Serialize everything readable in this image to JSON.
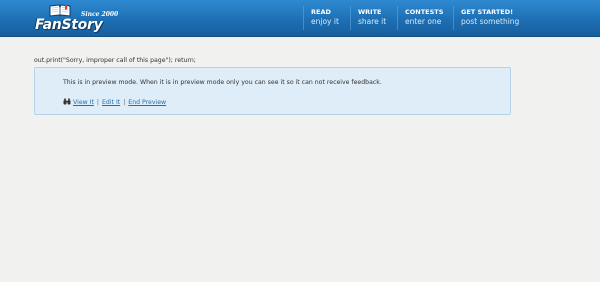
{
  "header": {
    "logo": {
      "wordmark": "FanStory",
      "tagline": "Since 2000"
    },
    "nav": [
      {
        "title": "READ",
        "subtitle": "enjoy it"
      },
      {
        "title": "WRITE",
        "subtitle": "share it"
      },
      {
        "title": "CONTESTS",
        "subtitle": "enter one"
      },
      {
        "title": "GET STARTED!",
        "subtitle": "post something"
      }
    ]
  },
  "main": {
    "code_text": "out.print(\"Sorry, improper call of this page\"); return;",
    "preview": {
      "message": "This is in preview mode. When it is in preview mode only you can see it so it can not receive feedback.",
      "links": {
        "view": "View It",
        "edit": "Edit It",
        "end": "End Preview",
        "separator": "|"
      }
    }
  },
  "colors": {
    "header": "#1d6fb4",
    "preview_bg": "#deedf8",
    "link": "#1e6fb5",
    "page_bg": "#f1f1ef"
  },
  "icons": {
    "logo": "book-icon",
    "view_link": "binoculars-icon"
  }
}
